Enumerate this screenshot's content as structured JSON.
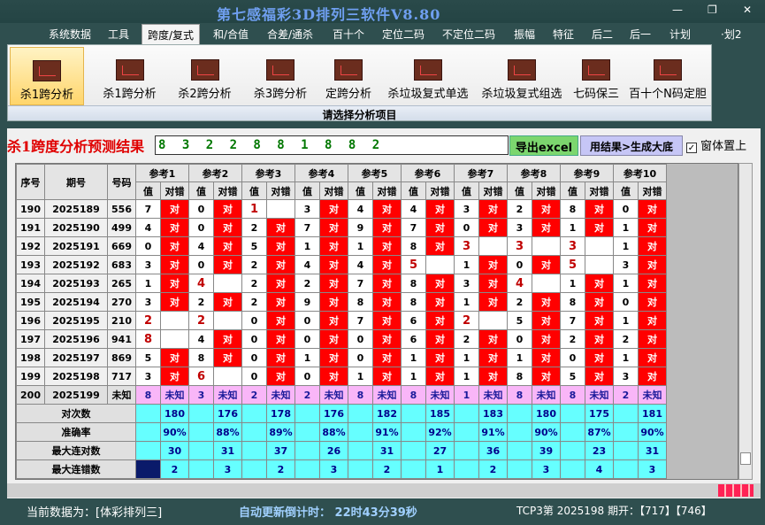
{
  "title": "第七感福彩3D排列三软件V8.80",
  "window": {
    "minimize": "—",
    "restore": "❐",
    "close": "✕"
  },
  "menu": [
    "系统数据",
    "工具",
    "跨度/复式",
    "和/合值",
    "合差/通杀",
    "百十个",
    "定位二码",
    "不定位二码",
    "振幅",
    "特征",
    "后二",
    "后一",
    "计划",
    "·划2"
  ],
  "active_menu": "跨度/复式",
  "ribbon": {
    "buttons": [
      "杀1跨分析",
      "杀1跨分析",
      "杀2跨分析",
      "杀3跨分析",
      "定跨分析",
      "杀垃圾复式单选",
      "杀垃圾复式组选",
      "七码保三",
      "百十个N码定胆"
    ],
    "selected": 0,
    "caption": "请选择分析项目"
  },
  "result": {
    "title": "杀1跨度分析预测结果",
    "value": "8 3 2 2 8 8 1 8 8 2",
    "export_label": "导出excel",
    "generate_label": "用结果>生成大底",
    "ontop_label": "窗体置上",
    "ontop_checked": true
  },
  "table": {
    "header_seq": "序号",
    "header_issue": "期号",
    "header_num": "号码",
    "ref_labels": [
      "参考1",
      "参考2",
      "参考3",
      "参考4",
      "参考5",
      "参考6",
      "参考7",
      "参考8",
      "参考9",
      "参考10"
    ],
    "sub_value": "值",
    "sub_judge": "对错",
    "judge_text": "对",
    "rows": [
      {
        "seq": "190",
        "issue": "2025189",
        "num": "556",
        "vals": [
          "7",
          "0",
          "1",
          "3",
          "4",
          "4",
          "3",
          "2",
          "8",
          "0"
        ],
        "hit": [
          1,
          1,
          0,
          1,
          1,
          1,
          1,
          1,
          1,
          1
        ],
        "trap": [
          0,
          0,
          1,
          0,
          0,
          0,
          0,
          0,
          0,
          0
        ]
      },
      {
        "seq": "191",
        "issue": "2025190",
        "num": "499",
        "vals": [
          "4",
          "0",
          "2",
          "7",
          "9",
          "7",
          "0",
          "3",
          "1",
          "1"
        ],
        "hit": [
          1,
          1,
          1,
          1,
          1,
          1,
          1,
          1,
          1,
          1
        ],
        "trap": [
          0,
          0,
          0,
          0,
          0,
          0,
          0,
          0,
          0,
          0
        ]
      },
      {
        "seq": "192",
        "issue": "2025191",
        "num": "669",
        "vals": [
          "0",
          "4",
          "5",
          "1",
          "1",
          "8",
          "3",
          "3",
          "3",
          "1"
        ],
        "hit": [
          1,
          1,
          1,
          1,
          1,
          1,
          0,
          0,
          0,
          1
        ],
        "trap": [
          0,
          0,
          0,
          0,
          0,
          0,
          1,
          1,
          1,
          0
        ]
      },
      {
        "seq": "193",
        "issue": "2025192",
        "num": "683",
        "vals": [
          "3",
          "0",
          "2",
          "4",
          "4",
          "5",
          "1",
          "0",
          "5",
          "3"
        ],
        "hit": [
          1,
          1,
          1,
          1,
          1,
          0,
          1,
          1,
          0,
          1
        ],
        "trap": [
          0,
          0,
          0,
          0,
          0,
          1,
          0,
          0,
          1,
          0
        ]
      },
      {
        "seq": "194",
        "issue": "2025193",
        "num": "265",
        "vals": [
          "1",
          "4",
          "2",
          "2",
          "7",
          "8",
          "3",
          "4",
          "1",
          "1"
        ],
        "hit": [
          1,
          0,
          1,
          1,
          1,
          1,
          1,
          0,
          1,
          1
        ],
        "trap": [
          0,
          1,
          0,
          0,
          0,
          0,
          0,
          1,
          0,
          0
        ]
      },
      {
        "seq": "195",
        "issue": "2025194",
        "num": "270",
        "vals": [
          "3",
          "2",
          "2",
          "9",
          "8",
          "8",
          "1",
          "2",
          "8",
          "0"
        ],
        "hit": [
          1,
          1,
          1,
          1,
          1,
          1,
          1,
          1,
          1,
          1
        ],
        "trap": [
          0,
          0,
          0,
          0,
          0,
          0,
          0,
          0,
          0,
          0
        ]
      },
      {
        "seq": "196",
        "issue": "2025195",
        "num": "210",
        "vals": [
          "2",
          "2",
          "0",
          "0",
          "7",
          "6",
          "2",
          "5",
          "7",
          "1"
        ],
        "hit": [
          0,
          0,
          1,
          1,
          1,
          1,
          0,
          1,
          1,
          1
        ],
        "trap": [
          1,
          1,
          0,
          0,
          0,
          0,
          1,
          0,
          0,
          0
        ]
      },
      {
        "seq": "197",
        "issue": "2025196",
        "num": "941",
        "vals": [
          "8",
          "4",
          "0",
          "0",
          "0",
          "6",
          "2",
          "0",
          "2",
          "2"
        ],
        "hit": [
          0,
          1,
          1,
          1,
          1,
          1,
          1,
          1,
          1,
          1
        ],
        "trap": [
          1,
          0,
          0,
          0,
          0,
          0,
          0,
          0,
          0,
          0
        ]
      },
      {
        "seq": "198",
        "issue": "2025197",
        "num": "869",
        "vals": [
          "5",
          "8",
          "0",
          "1",
          "0",
          "1",
          "1",
          "1",
          "0",
          "1"
        ],
        "hit": [
          1,
          1,
          1,
          1,
          1,
          1,
          1,
          1,
          1,
          1
        ],
        "trap": [
          0,
          0,
          0,
          0,
          0,
          0,
          0,
          0,
          0,
          0
        ]
      },
      {
        "seq": "199",
        "issue": "2025198",
        "num": "717",
        "vals": [
          "3",
          "6",
          "0",
          "0",
          "1",
          "1",
          "1",
          "8",
          "5",
          "3"
        ],
        "hit": [
          1,
          0,
          1,
          1,
          1,
          1,
          1,
          1,
          1,
          1
        ],
        "trap": [
          0,
          1,
          0,
          0,
          0,
          0,
          0,
          0,
          0,
          0
        ]
      }
    ],
    "pending": {
      "seq": "200",
      "issue": "2025199",
      "num": "未知",
      "vals": [
        "8",
        "3",
        "2",
        "2",
        "8",
        "8",
        "1",
        "8",
        "8",
        "2"
      ],
      "judge": "未知"
    },
    "stats": [
      {
        "label": "对次数",
        "values": [
          "180",
          "176",
          "178",
          "176",
          "182",
          "185",
          "183",
          "180",
          "175",
          "181"
        ]
      },
      {
        "label": "准确率",
        "values": [
          "90%",
          "88%",
          "89%",
          "88%",
          "91%",
          "92%",
          "91%",
          "90%",
          "87%",
          "90%"
        ]
      },
      {
        "label": "最大连对数",
        "values": [
          "30",
          "31",
          "37",
          "26",
          "31",
          "27",
          "36",
          "39",
          "23",
          "31"
        ]
      },
      {
        "label": "最大连错数",
        "values": [
          "2",
          "3",
          "2",
          "3",
          "2",
          "1",
          "2",
          "3",
          "4",
          "3"
        ]
      }
    ]
  },
  "status": {
    "current_data": "当前数据为：[体彩排列三]",
    "countdown": "自动更新倒计时： 22时43分39秒",
    "draw_info": "TCP3第 2025198 期开：【717】【746】"
  },
  "colors": {
    "hit": "#ff0000",
    "cyan": "#66ffff",
    "pending": "#f9b6f8",
    "navy": "#0a1a6a"
  }
}
